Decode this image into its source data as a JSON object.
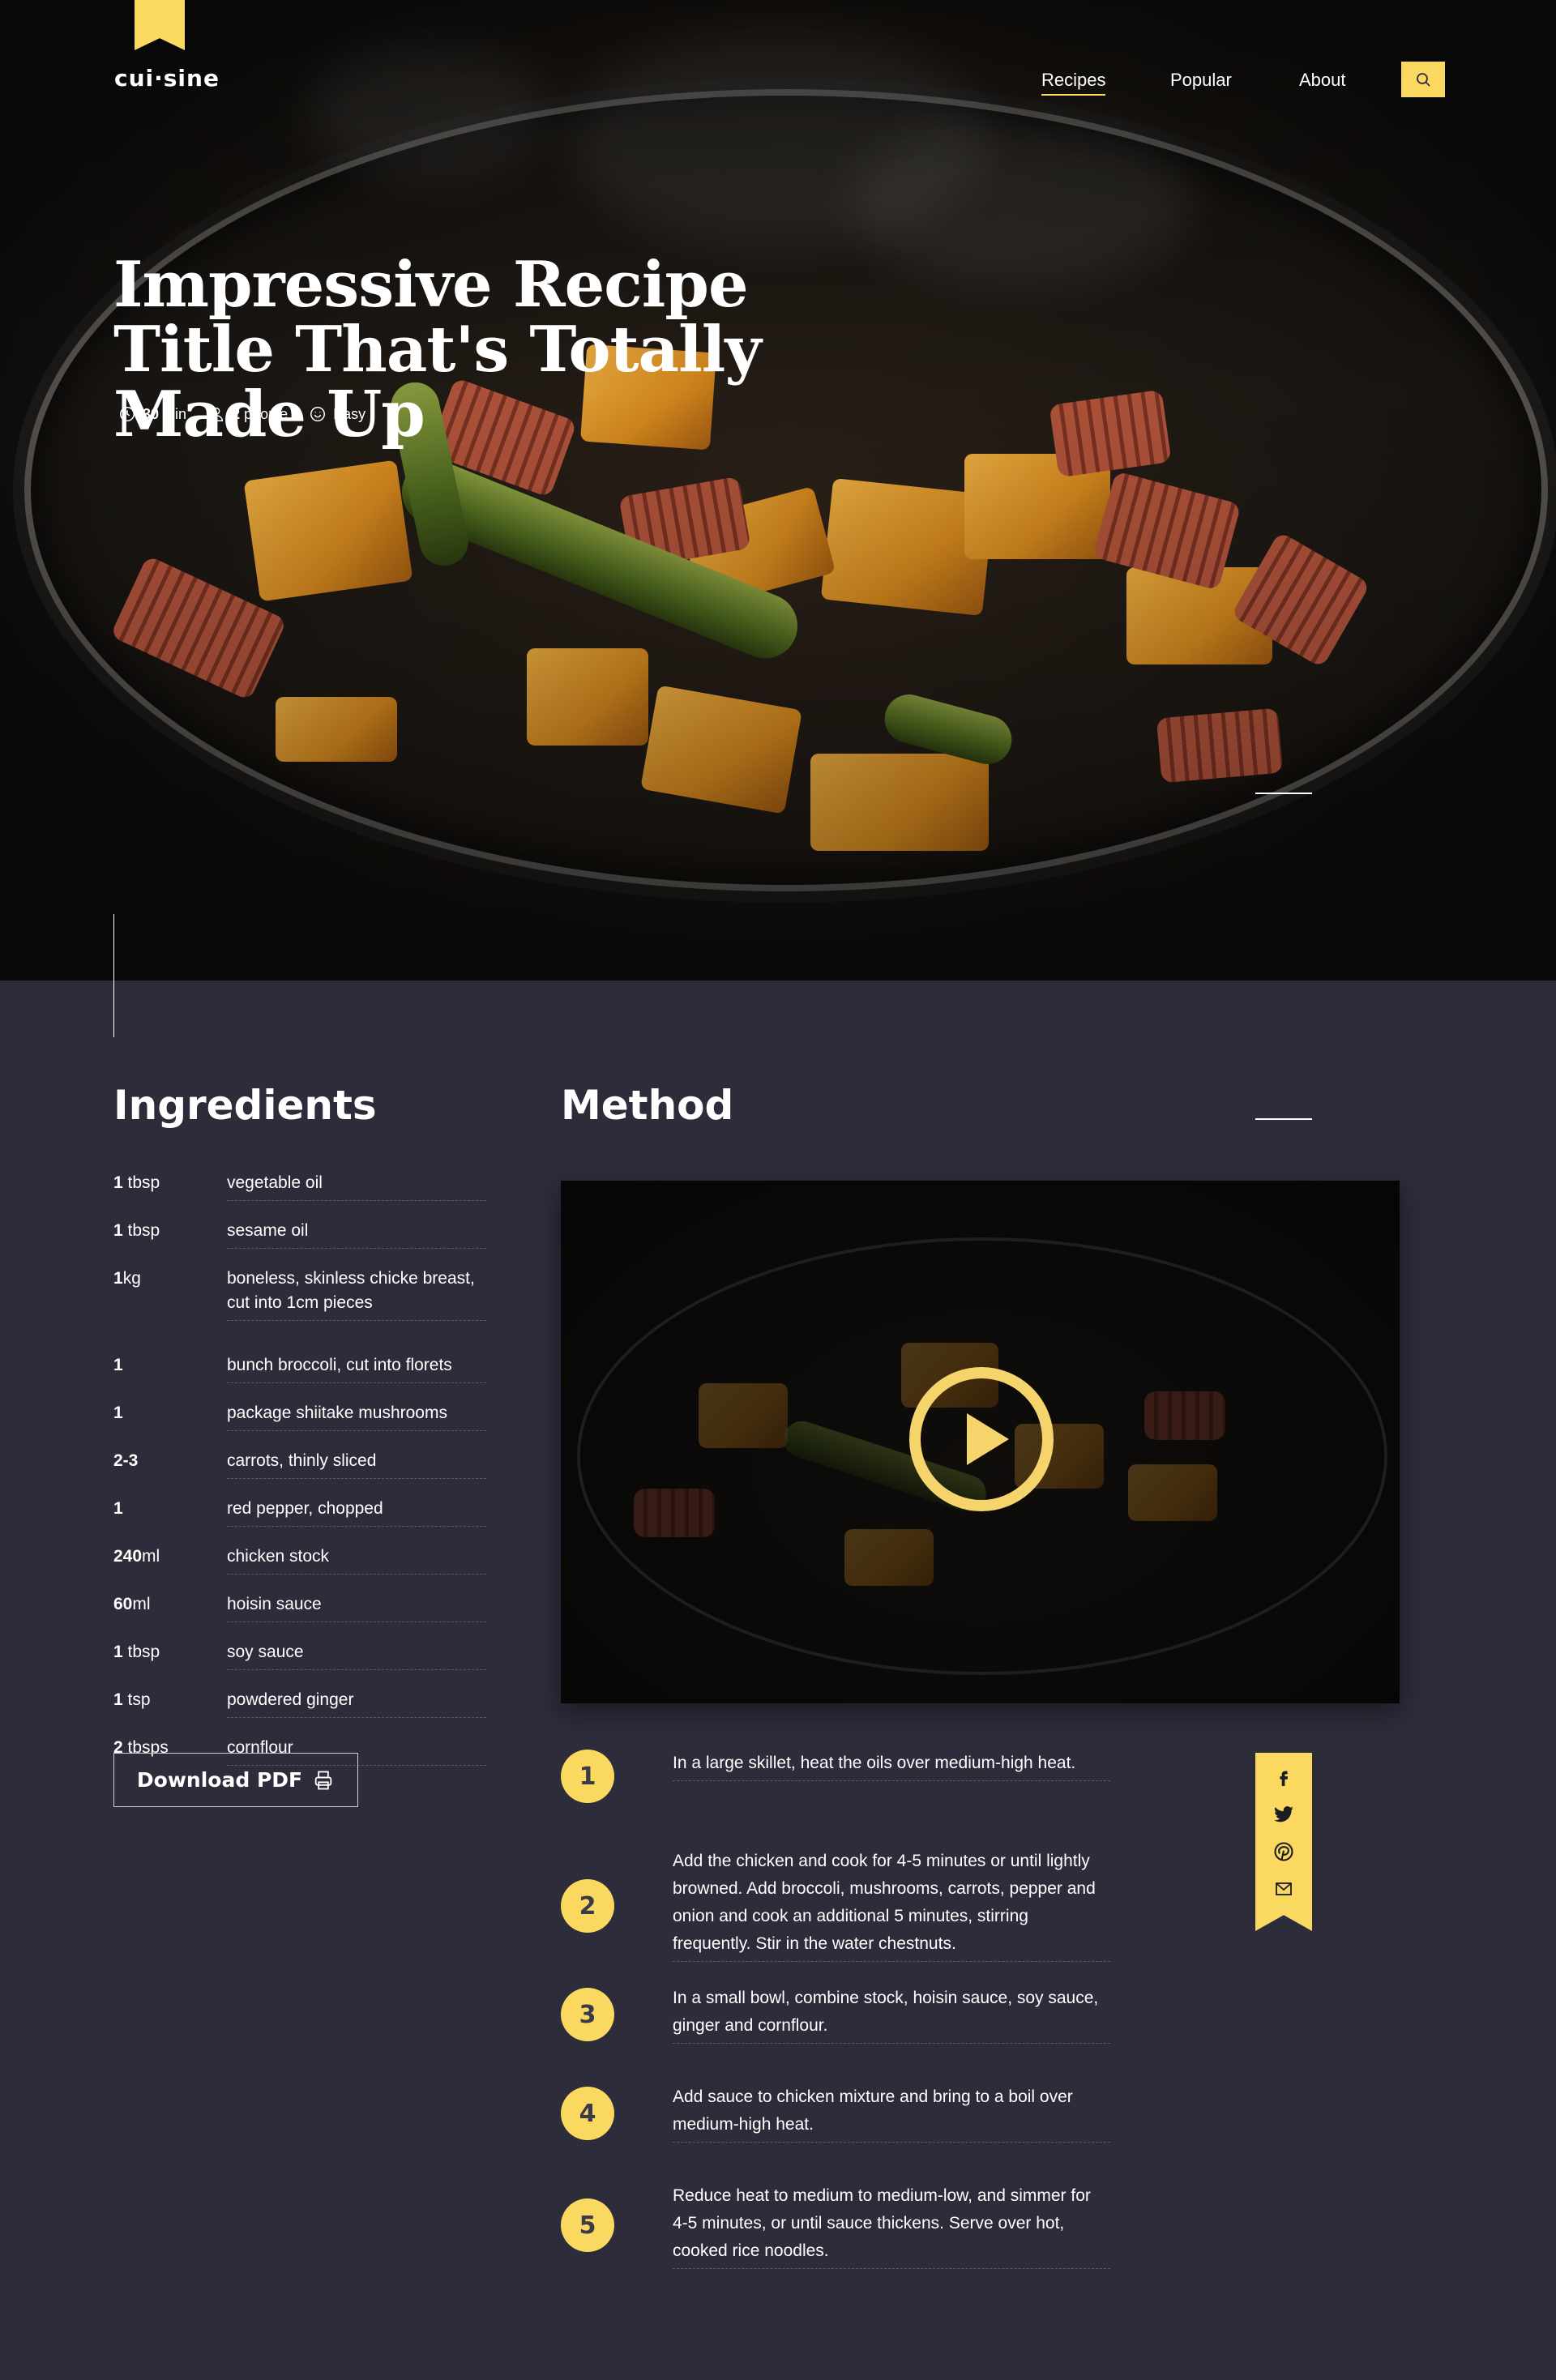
{
  "brand": {
    "logo": "cui·sine",
    "accent": "#fbd960",
    "background": "#2c2c3a"
  },
  "nav": {
    "items": [
      {
        "label": "Recipes",
        "active": true
      },
      {
        "label": "Popular",
        "active": false
      },
      {
        "label": "About",
        "active": false
      }
    ],
    "search_icon": "search-icon"
  },
  "hero": {
    "title": "Impressive Recipe Title That's Totally Made Up",
    "meta": {
      "time_value": "30",
      "time_unit": "min",
      "people_value": "2",
      "people_unit": "people",
      "difficulty": "Easy"
    }
  },
  "ingredients": {
    "heading": "Ingredients",
    "items": [
      {
        "qty_num": "1",
        "qty_unit": " tbsp",
        "name": "vegetable oil"
      },
      {
        "qty_num": "1",
        "qty_unit": " tbsp",
        "name": "sesame oil"
      },
      {
        "qty_num": "1",
        "qty_unit": "kg",
        "name": "boneless, skinless chicke breast, cut into 1cm pieces"
      },
      {
        "qty_num": "1",
        "qty_unit": "",
        "name": "bunch broccoli, cut into florets"
      },
      {
        "qty_num": "1",
        "qty_unit": "",
        "name": "package shiitake mushrooms"
      },
      {
        "qty_num": "2-3",
        "qty_unit": "",
        "name": "carrots, thinly sliced"
      },
      {
        "qty_num": "1",
        "qty_unit": "",
        "name": "red pepper, chopped"
      },
      {
        "qty_num": "240",
        "qty_unit": "ml",
        "name": "chicken stock"
      },
      {
        "qty_num": "60",
        "qty_unit": "ml",
        "name": "hoisin sauce"
      },
      {
        "qty_num": "1",
        "qty_unit": " tbsp",
        "name": "soy sauce"
      },
      {
        "qty_num": "1",
        "qty_unit": " tsp",
        "name": "powdered ginger"
      },
      {
        "qty_num": "2",
        "qty_unit": " tbsps",
        "name": "cornflour"
      }
    ],
    "download_label": "Download PDF"
  },
  "method": {
    "heading": "Method",
    "steps": [
      {
        "num": "1",
        "text": "In a large skillet, heat the oils over medium-high heat."
      },
      {
        "num": "2",
        "text": "Add the chicken and cook for 4-5 minutes or until lightly browned. Add broccoli, mushrooms, carrots, pepper and onion and cook an additional 5 minutes, stirring frequently. Stir in the water chestnuts."
      },
      {
        "num": "3",
        "text": "In a small bowl, combine stock, hoisin sauce, soy sauce, ginger and cornflour."
      },
      {
        "num": "4",
        "text": "Add sauce to chicken mixture and bring to a boil over medium-high heat."
      },
      {
        "num": "5",
        "text": "Reduce heat to medium to medium-low, and simmer for 4-5 minutes, or until sauce thickens. Serve over hot, cooked rice noodles."
      }
    ]
  },
  "share": {
    "icons": [
      "facebook-icon",
      "twitter-icon",
      "pinterest-icon",
      "mail-icon"
    ]
  }
}
